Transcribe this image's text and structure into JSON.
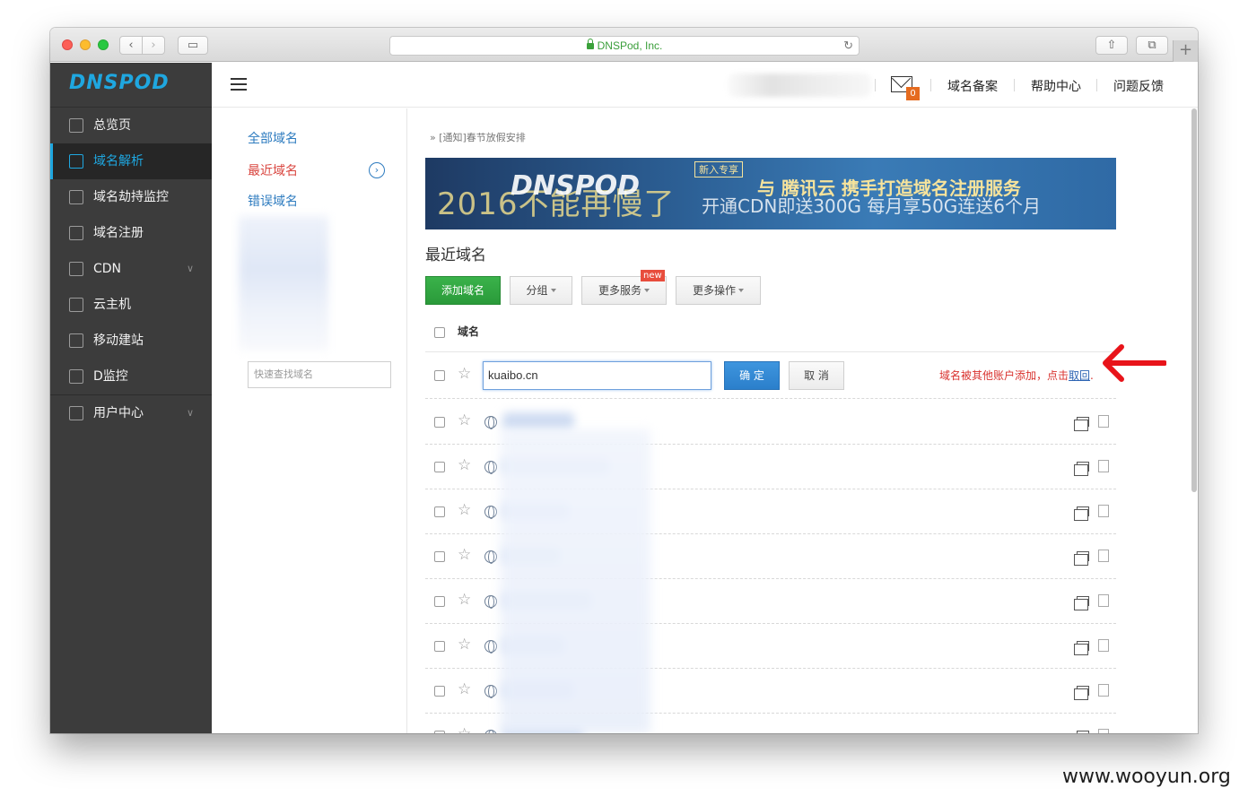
{
  "browser": {
    "url_title": "DNSPod, Inc.",
    "new_tab_symbol": "+"
  },
  "sidebar": {
    "logo": "DNSPOD",
    "items": [
      {
        "label": "总览页",
        "icon": "home-icon"
      },
      {
        "label": "域名解析",
        "icon": "dns-icon"
      },
      {
        "label": "域名劫持监控",
        "icon": "monitor-icon"
      },
      {
        "label": "域名注册",
        "icon": "register-icon"
      },
      {
        "label": "CDN",
        "icon": "cdn-icon"
      },
      {
        "label": "云主机",
        "icon": "server-icon"
      },
      {
        "label": "移动建站",
        "icon": "mobile-site-icon"
      },
      {
        "label": "D监控",
        "icon": "shield-icon"
      },
      {
        "label": "用户中心",
        "icon": "user-icon"
      }
    ],
    "accent_color": "#1fa7e0"
  },
  "header": {
    "mail_count": "0",
    "links": [
      "域名备案",
      "帮助中心",
      "问题反馈"
    ]
  },
  "subnav": {
    "links": [
      "全部域名",
      "最近域名",
      "错误域名"
    ],
    "search_placeholder": "快速查找域名"
  },
  "main": {
    "notice": "» [通知]春节放假安排",
    "banner": {
      "slogan": "2016不能再慢了",
      "logo": "DNSPOD",
      "tag": "新入专享",
      "title": "与 腾讯云  携手打造域名注册服务",
      "subtitle": "开通CDN即送300G 每月享50G连送6个月"
    },
    "section_title": "最近域名",
    "buttons": {
      "add": "添加域名",
      "group": "分组",
      "more_services": "更多服务",
      "more_ops": "更多操作",
      "new_badge": "new"
    },
    "table_header": "域名",
    "edit_row": {
      "input_value": "kuaibo.cn",
      "ok": "确 定",
      "cancel": "取 消",
      "conflict_text": "域名被其他账户添加，点击",
      "reclaim_link": "取回",
      "conflict_suffix": "."
    }
  },
  "watermark": "www.wooyun.org"
}
